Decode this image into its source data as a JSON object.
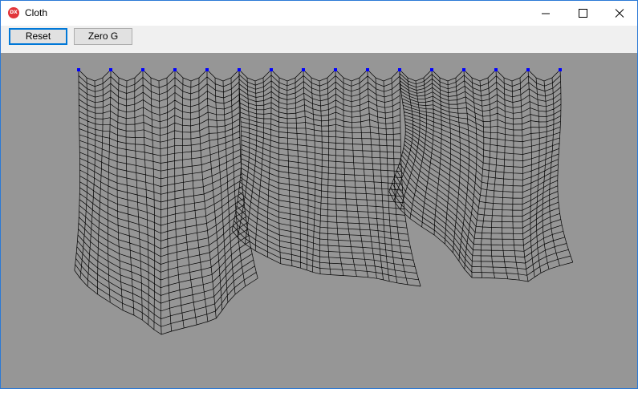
{
  "window": {
    "title": "Cloth",
    "icon": "dx-app-icon",
    "icon_text": "DX",
    "accent_color": "#0078d7"
  },
  "controls": {
    "minimize": "minimize-icon",
    "maximize": "maximize-icon",
    "close": "close-icon"
  },
  "toolbar": {
    "reset_label": "Reset",
    "zero_g_label": "Zero G"
  },
  "scene": {
    "background_color": "#969696",
    "mesh_color": "#000000",
    "pin_color": "#0000ff",
    "pin_count": 16,
    "cloth_panels": 3
  }
}
